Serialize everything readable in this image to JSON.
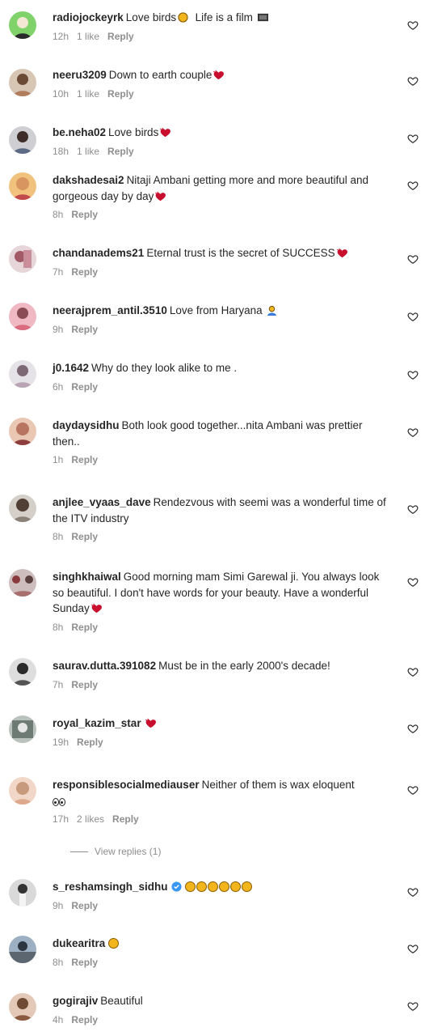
{
  "colors": {
    "heart": "#e0245e",
    "text": "#262626",
    "meta": "#8e8e8e",
    "verified": "#3897f0"
  },
  "comments": [
    {
      "user": "radiojockeyrk",
      "text": "Love birds",
      "text2": "Life is a film",
      "time": "12h",
      "likes": "1 like",
      "reply": "Reply"
    },
    {
      "user": "neeru3209",
      "text": "Down to earth couple",
      "time": "10h",
      "likes": "1 like",
      "reply": "Reply"
    },
    {
      "user": "be.neha02",
      "text": "Love birds",
      "time": "18h",
      "likes": "1 like",
      "reply": "Reply"
    },
    {
      "user": "dakshadesai2",
      "text": "Nitaji Ambani getting more and more beautiful and gorgeous day by day",
      "time": "8h",
      "reply": "Reply"
    },
    {
      "user": "chandanadems21",
      "text": "Eternal trust is the secret of SUCCESS",
      "time": "7h",
      "reply": "Reply"
    },
    {
      "user": "neerajprem_antil.3510",
      "text": "Love from Haryana",
      "time": "9h",
      "reply": "Reply"
    },
    {
      "user": "j0.1642",
      "text": "Why do they look alike to me .",
      "time": "6h",
      "reply": "Reply"
    },
    {
      "user": "daydaysidhu",
      "text": "Both look good together...nita Ambani was prettier then..",
      "time": "1h",
      "reply": "Reply"
    },
    {
      "user": "anjlee_vyaas_dave",
      "text": "Rendezvous with seemi was a wonderful time of the ITV industry",
      "time": "8h",
      "reply": "Reply"
    },
    {
      "user": "singhkhaiwal",
      "text": "Good morning mam Simi Garewal ji. You always look so beautiful. I don't have words for your beauty. Have a wonderful Sunday",
      "time": "8h",
      "reply": "Reply"
    },
    {
      "user": "saurav.dutta.391082",
      "text": "Must be in the early 2000's decade!",
      "time": "7h",
      "reply": "Reply"
    },
    {
      "user": "royal_kazim_star",
      "text": "",
      "time": "19h",
      "reply": "Reply"
    },
    {
      "user": "responsiblesocialmediauser",
      "text": "Neither of them is wax eloquent",
      "time": "17h",
      "likes": "2 likes",
      "reply": "Reply"
    },
    {
      "user": "s_reshamsingh_sidhu",
      "text": "",
      "time": "9h",
      "reply": "Reply"
    },
    {
      "user": "dukearitra",
      "text": "",
      "time": "8h",
      "reply": "Reply"
    },
    {
      "user": "gogirajiv",
      "text": "Beautiful",
      "time": "4h",
      "reply": "Reply"
    }
  ],
  "view_replies": "View replies (1)"
}
